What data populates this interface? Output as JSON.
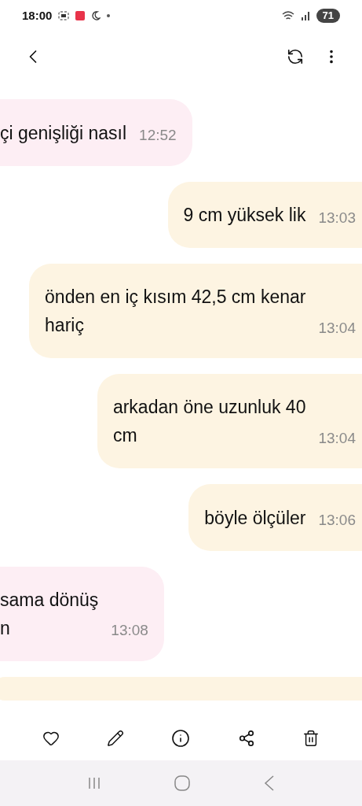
{
  "status_bar": {
    "time": "18:00",
    "battery": "71"
  },
  "messages": [
    {
      "kind": "received",
      "lines": [
        "çi genişliği nasıl"
      ],
      "time": "12:52"
    },
    {
      "kind": "sent",
      "lines": [
        "9 cm yüksek lik"
      ],
      "time": "13:03"
    },
    {
      "kind": "sent",
      "lines": [
        "önden en iç kısım 42,5 cm kenar",
        "hariç"
      ],
      "time": "13:04"
    },
    {
      "kind": "sent",
      "lines": [
        "arkadan öne uzunluk 40",
        "cm"
      ],
      "time": "13:04"
    },
    {
      "kind": "sent",
      "lines": [
        "böyle ölçüler"
      ],
      "time": "13:06"
    },
    {
      "kind": "received",
      "lines": [
        "sama dönüş",
        "n"
      ],
      "time": "13:08"
    }
  ]
}
